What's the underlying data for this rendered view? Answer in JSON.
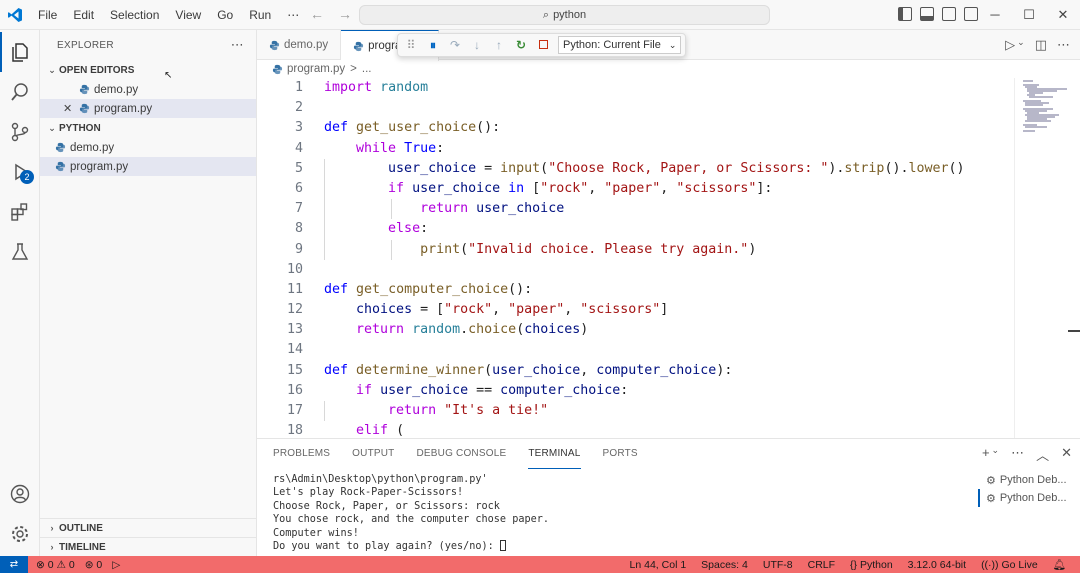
{
  "titlebar": {
    "menu": [
      "File",
      "Edit",
      "Selection",
      "View",
      "Go",
      "Run",
      "⋯"
    ],
    "search_text": "python"
  },
  "activity_badge": "2",
  "explorer": {
    "title": "EXPLORER",
    "open_editors_header": "OPEN EDITORS",
    "open_editors": [
      "demo.py",
      "program.py"
    ],
    "folder_header": "PYTHON",
    "files": [
      "demo.py",
      "program.py"
    ],
    "outline": "OUTLINE",
    "timeline": "TIMELINE"
  },
  "tabs": [
    "demo.py",
    "program.py"
  ],
  "debug_toolbar": {
    "config": "Python: Current File"
  },
  "breadcrumb": {
    "file": "program.py",
    "sep": ">",
    "more": "..."
  },
  "code_lines": [
    "import random",
    "",
    "def get_user_choice():",
    "    while True:",
    "        user_choice = input(\"Choose Rock, Paper, or Scissors: \").strip().lower()",
    "        if user_choice in [\"rock\", \"paper\", \"scissors\"]:",
    "            return user_choice",
    "        else:",
    "            print(\"Invalid choice. Please try again.\")",
    "",
    "def get_computer_choice():",
    "    choices = [\"rock\", \"paper\", \"scissors\"]",
    "    return random.choice(choices)",
    "",
    "def determine_winner(user_choice, computer_choice):",
    "    if user_choice == computer_choice:",
    "        return \"It's a tie!\"",
    "    elif ("
  ],
  "panel": {
    "tabs": [
      "PROBLEMS",
      "OUTPUT",
      "DEBUG CONSOLE",
      "TERMINAL",
      "PORTS"
    ],
    "active_tab": "TERMINAL",
    "terminal_lines": [
      "rs\\Admin\\Desktop\\python\\program.py'",
      "Let's play Rock-Paper-Scissors!",
      "Choose Rock, Paper, or Scissors: rock",
      "You chose rock, and the computer chose paper.",
      "Computer wins!",
      "Do you want to play again? (yes/no): "
    ],
    "terminal_sessions": [
      "Python Deb...",
      "Python Deb..."
    ]
  },
  "statusbar": {
    "errors": "0",
    "warnings": "0",
    "ports": "0",
    "position": "Ln 44, Col 1",
    "spaces": "Spaces: 4",
    "encoding": "UTF-8",
    "eol": "CRLF",
    "language": "Python",
    "interpreter": "3.12.0 64-bit",
    "golive": "Go Live",
    "color": "#f26b6b"
  }
}
